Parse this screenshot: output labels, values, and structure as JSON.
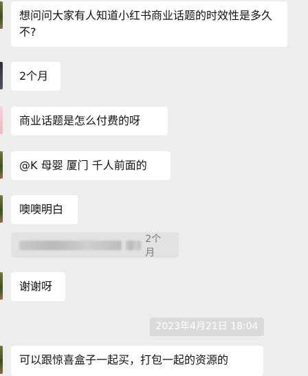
{
  "messages": [
    {
      "text": "想问问大家有人知道小红书商业话题的时效性是多久不?"
    },
    {
      "text": "2个月"
    },
    {
      "text": "商业话题是怎么付费的呀"
    },
    {
      "text": "@K 母婴 厦门 千人前面的"
    },
    {
      "text": "噢噢明白"
    },
    {
      "text": "谢谢呀"
    },
    {
      "text": "可以跟惊喜盒子一起买，打包一起的资源的"
    }
  ],
  "quote": {
    "text": "2个月"
  },
  "timestamp": "2023年4月21日 18:04"
}
